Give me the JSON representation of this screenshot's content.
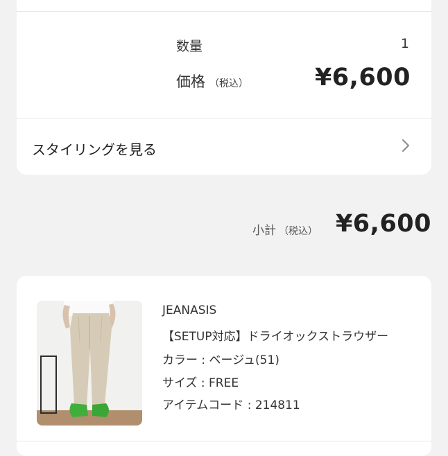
{
  "summary": {
    "quantity_label": "数量",
    "quantity_value": "1",
    "price_label": "価格",
    "price_tax": "（税込）",
    "price_value": "¥6,600",
    "styling_link_label": "スタイリングを見る"
  },
  "subtotal": {
    "label": "小計",
    "tax": "（税込）",
    "value": "¥6,600"
  },
  "item": {
    "brand": "JEANASIS",
    "name": "【SETUP対応】ドライオックストラウザー",
    "color": "カラー : ベージュ(51)",
    "size": "サイズ : FREE",
    "code": "アイテムコード : 214811"
  },
  "icons": {
    "chevron": "chevron-right-icon"
  }
}
